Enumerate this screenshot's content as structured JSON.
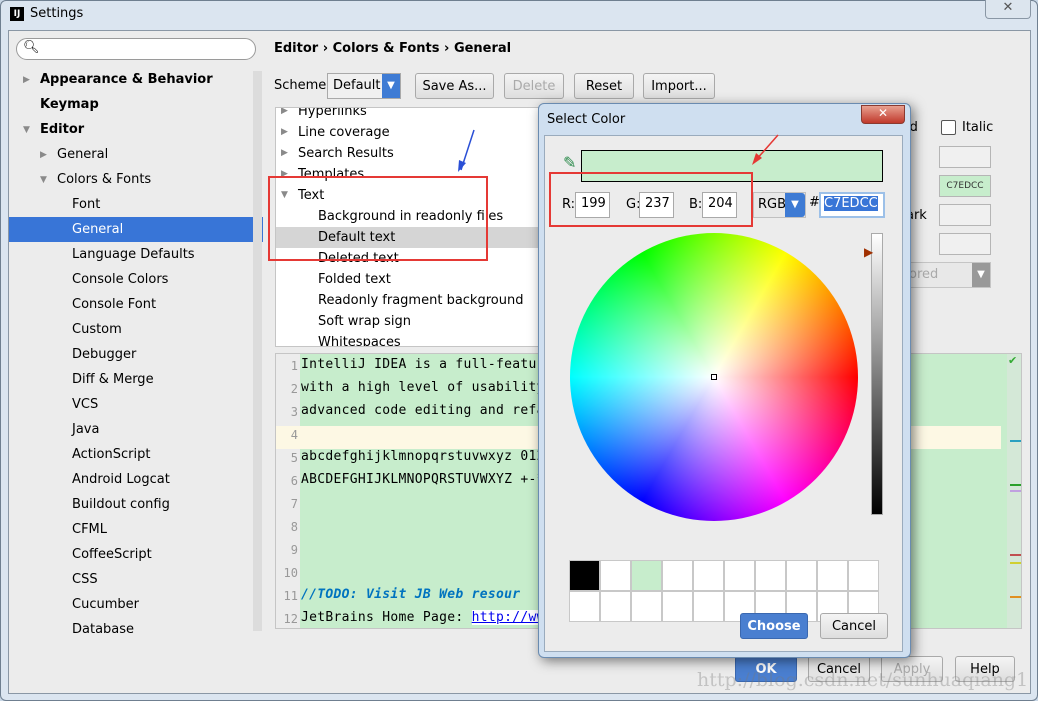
{
  "window": {
    "title": "Settings",
    "icon": "intellij-icon"
  },
  "sidebar": {
    "search_placeholder": "",
    "items": [
      {
        "label": "Appearance & Behavior",
        "level": 0,
        "bold": true,
        "expanded": false
      },
      {
        "label": "Keymap",
        "level": 0,
        "bold": true
      },
      {
        "label": "Editor",
        "level": 0,
        "bold": true,
        "expanded": true
      },
      {
        "label": "General",
        "level": 1,
        "expanded": false
      },
      {
        "label": "Colors & Fonts",
        "level": 1,
        "expanded": true
      },
      {
        "label": "Font",
        "level": 2
      },
      {
        "label": "General",
        "level": 2,
        "selected": true
      },
      {
        "label": "Language Defaults",
        "level": 2
      },
      {
        "label": "Console Colors",
        "level": 2
      },
      {
        "label": "Console Font",
        "level": 2
      },
      {
        "label": "Custom",
        "level": 2
      },
      {
        "label": "Debugger",
        "level": 2
      },
      {
        "label": "Diff & Merge",
        "level": 2
      },
      {
        "label": "VCS",
        "level": 2
      },
      {
        "label": "Java",
        "level": 2
      },
      {
        "label": "ActionScript",
        "level": 2
      },
      {
        "label": "Android Logcat",
        "level": 2
      },
      {
        "label": "Buildout config",
        "level": 2
      },
      {
        "label": "CFML",
        "level": 2
      },
      {
        "label": "CoffeeScript",
        "level": 2
      },
      {
        "label": "CSS",
        "level": 2
      },
      {
        "label": "Cucumber",
        "level": 2
      },
      {
        "label": "Database",
        "level": 2
      }
    ]
  },
  "main": {
    "breadcrumb": [
      "Editor",
      "Colors & Fonts",
      "General"
    ],
    "breadcrumb_sep": "›",
    "scheme_label": "Scheme:",
    "scheme_value": "Default",
    "save_as": "Save As...",
    "delete": "Delete",
    "reset": "Reset",
    "import": "Import...",
    "tree": [
      {
        "label": "Hyperlinks",
        "level": 0,
        "arrow": true
      },
      {
        "label": "Line coverage",
        "level": 0,
        "arrow": true
      },
      {
        "label": "Search Results",
        "level": 0,
        "arrow": true
      },
      {
        "label": "Templates",
        "level": 0,
        "arrow": true
      },
      {
        "label": "Text",
        "level": 0,
        "arrow": true,
        "expanded": true
      },
      {
        "label": "Background in readonly files",
        "level": 1
      },
      {
        "label": "Default text",
        "level": 1,
        "selected": true
      },
      {
        "label": "Deleted text",
        "level": 1
      },
      {
        "label": "Folded text",
        "level": 1
      },
      {
        "label": "Readonly fragment background",
        "level": 1
      },
      {
        "label": "Soft wrap sign",
        "level": 1
      },
      {
        "label": "Whitespaces",
        "level": 1
      }
    ],
    "options": {
      "bold_partial": "ld",
      "italic": "Italic",
      "mark_partial": "ark",
      "dropdown_partial": "ored",
      "bg_color_value": "C7EDCC"
    },
    "preview_lines": [
      {
        "n": "1",
        "text": "IntelliJ IDEA is a full-featur"
      },
      {
        "n": "2",
        "text": "with a high level of usability"
      },
      {
        "n": "3",
        "text": "advanced code editing and refa"
      },
      {
        "n": "4",
        "text": ""
      },
      {
        "n": "5",
        "text": "abcdefghijklmnopqrstuvwxyz 012"
      },
      {
        "n": "6",
        "text": "ABCDEFGHIJKLMNOPQRSTUVWXYZ +-*"
      },
      {
        "n": "7",
        "text": ""
      },
      {
        "n": "8",
        "text": ""
      },
      {
        "n": "9",
        "text": ""
      },
      {
        "n": "10",
        "text": ""
      },
      {
        "n": "11",
        "text": "//TODO: Visit JB Web resour"
      },
      {
        "n": "12",
        "text": "JetBrains Home Page: ",
        "link": "http://ww"
      }
    ]
  },
  "footer": {
    "ok": "OK",
    "cancel": "Cancel",
    "apply": "Apply",
    "help": "Help"
  },
  "dialog": {
    "title": "Select Color",
    "r_label": "R:",
    "r": "199",
    "g_label": "G:",
    "g": "237",
    "b_label": "B:",
    "b": "204",
    "mode": "RGB",
    "hash": "#",
    "hex": "C7EDCC",
    "choose": "Choose",
    "cancel": "Cancel",
    "swatches": [
      "#000000",
      "#ffffff",
      "#c7edcc",
      "#ffffff",
      "#ffffff",
      "#ffffff",
      "#ffffff",
      "#ffffff",
      "#ffffff",
      "#ffffff",
      "#ffffff",
      "#ffffff",
      "#ffffff",
      "#ffffff",
      "#ffffff",
      "#ffffff",
      "#ffffff",
      "#ffffff",
      "#ffffff",
      "#ffffff"
    ]
  },
  "colors": {
    "accent": "#3875d7",
    "preview_bg": "#c7edcc",
    "annotation_red": "#e53935",
    "annotation_blue": "#2a4fd6",
    "caret_row": "#fdf8e4"
  },
  "watermark": "http://blog.csdn.net/sunhuaqiang1"
}
